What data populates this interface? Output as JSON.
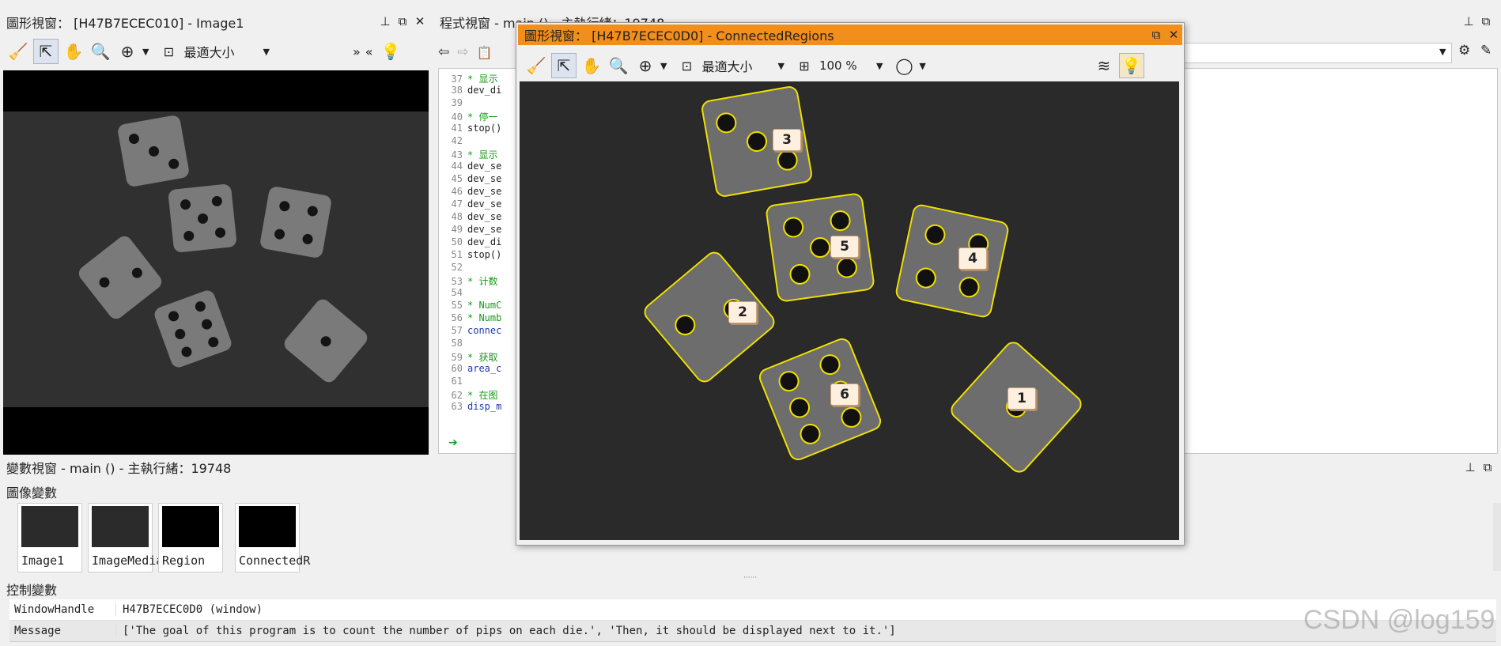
{
  "left_window": {
    "title": "圖形視窗： [H47B7ECEC010] - Image1",
    "zoom_label": "最適大小"
  },
  "program_window": {
    "title": "程式視窗 - main () - 主執行緒：19748",
    "lines": [
      {
        "n": "37",
        "text": "* 显示",
        "cls": "cm"
      },
      {
        "n": "38",
        "text": "dev_di",
        "cls": ""
      },
      {
        "n": "39",
        "text": "",
        "cls": ""
      },
      {
        "n": "40",
        "text": "* 停一",
        "cls": "cm"
      },
      {
        "n": "41",
        "text": "stop()",
        "cls": ""
      },
      {
        "n": "42",
        "text": "",
        "cls": ""
      },
      {
        "n": "43",
        "text": "* 显示",
        "cls": "cm"
      },
      {
        "n": "44",
        "text": "dev_se",
        "cls": ""
      },
      {
        "n": "45",
        "text": "dev_se",
        "cls": ""
      },
      {
        "n": "46",
        "text": "dev_se",
        "cls": ""
      },
      {
        "n": "47",
        "text": "dev_se",
        "cls": ""
      },
      {
        "n": "48",
        "text": "dev_se",
        "cls": ""
      },
      {
        "n": "49",
        "text": "dev_se",
        "cls": ""
      },
      {
        "n": "50",
        "text": "dev_di",
        "cls": ""
      },
      {
        "n": "51",
        "text": "stop()",
        "cls": ""
      },
      {
        "n": "52",
        "text": "",
        "cls": ""
      },
      {
        "n": "53",
        "text": "* 计数",
        "cls": "cm"
      },
      {
        "n": "54",
        "text": "",
        "cls": ""
      },
      {
        "n": "55",
        "text": "* NumC",
        "cls": "cm"
      },
      {
        "n": "56",
        "text": "* Numb",
        "cls": "cm"
      },
      {
        "n": "57",
        "text": "connec",
        "cls": "kw"
      },
      {
        "n": "58",
        "text": "",
        "cls": ""
      },
      {
        "n": "59",
        "text": "* 获取",
        "cls": "cm"
      },
      {
        "n": "60",
        "text": "area_c",
        "cls": "kw"
      },
      {
        "n": "61",
        "text": "",
        "cls": ""
      },
      {
        "n": "62",
        "text": "* 在图",
        "cls": "cm"
      },
      {
        "n": "63",
        "text": "disp_m",
        "cls": "kw"
      }
    ]
  },
  "float_window": {
    "title": "圖形視窗： [H47B7ECEC0D0] - ConnectedRegions",
    "zoom_label": "最適大小",
    "zoom_percent": "100 %",
    "labels": [
      "3",
      "5",
      "4",
      "2",
      "6",
      "1"
    ]
  },
  "variables_window": {
    "title": "變數視窗 - main () - 主執行緒：19748",
    "image_section": "圖像變數",
    "thumbnails": [
      "Image1",
      "ImageMedia",
      "Region",
      "ConnectedR"
    ],
    "control_section": "控制變數",
    "control_rows": [
      {
        "name": "WindowHandle",
        "value": "H47B7ECEC0D0 (window)"
      },
      {
        "name": "Message",
        "value": "['The goal of this program is to count the number of pips on each die.', 'Then, it should be displayed next to it.']"
      }
    ]
  },
  "watermark": "CSDN @log159",
  "colors": {
    "orange_title": "#f28e1c",
    "region_yellow": "#f0e000"
  }
}
